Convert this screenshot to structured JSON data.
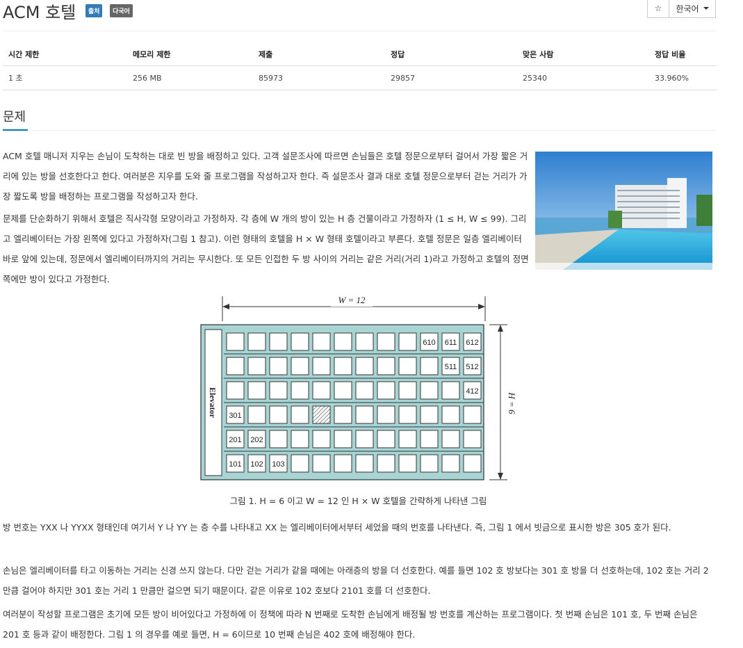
{
  "header": {
    "title": "ACM 호텔",
    "badges": [
      "출처",
      "다국어"
    ],
    "star_glyph": "☆",
    "language": "한국어"
  },
  "stats": {
    "headers": [
      "시간 제한",
      "메모리 제한",
      "제출",
      "정답",
      "맞은 사람",
      "정답 비율"
    ],
    "values": [
      "1 초",
      "256 MB",
      "85973",
      "29857",
      "25340",
      "33.960%"
    ]
  },
  "section_title": "문제",
  "paragraphs": [
    "ACM 호텔 매니저 지우는 손님이 도착하는 대로 빈 방을 배정하고 있다. 고객 설문조사에 따르면 손님들은 호텔 정문으로부터 걸어서 가장 짧은 거리에 있는 방을 선호한다고 한다. 여러분은 지우를 도와 줄 프로그램을 작성하고자 한다. 즉 설문조사 결과 대로 호텔 정문으로부터 걷는 거리가 가장 짧도록 방을 배정하는 프로그램을 작성하고자 한다.",
    "문제를 단순화하기 위해서 호텔은 직사각형 모양이라고 가정하자. 각 층에 W 개의 방이 있는 H 층 건물이라고 가정하자 (1 ≤ H, W ≤ 99). 그리고 엘리베이터는 가장 왼쪽에 있다고 가정하자(그림 1 참고). 이런 형태의 호텔을 H × W 형태 호텔이라고 부른다. 호텔 정문은 일층 엘리베이터 바로 앞에 있는데, 정문에서 엘리베이터까지의 거리는 무시한다. 또 모든 인접한 두 방 사이의 거리는 같은 거리(거리 1)라고 가정하고 호텔의 정면 쪽에만 방이 있다고 가정한다.",
    "방 번호는 YXX 나 YYXX 형태인데 여기서 Y 나 YY 는 층 수를 나타내고 XX 는 엘리베이터에서부터 세었을 때의 번호를 나타낸다. 즉, 그림 1 에서 빗금으로 표시한 방은 305 호가 된다.",
    "손님은 엘리베이터를 타고 이동하는 거리는 신경 쓰지 않는다. 다만 걷는 거리가 같을 때에는 아래층의 방을 더 선호한다. 예를 들면 102 호 방보다는 301 호 방을 더 선호하는데, 102 호는 거리 2 만큼 걸어야 하지만 301 호는 거리 1 만큼만 걸으면 되기 때문이다. 같은 이유로 102 호보다 2101 호를 더 선호한다.",
    "여러분이 작성할 프로그램은 초기에 모든 방이 비어있다고 가정하에 이 정책에 따라 N 번째로 도착한 손님에게 배정될 방 번호를 계산하는 프로그램이다. 첫 번째 손님은 101 호, 두 번째 손님은 201 호 등과 같이 배정한다. 그림 1 의 경우를 예로 들면, H = 6이므로 10 번째 손님은 402 호에 배정해야 한다."
  ],
  "figure": {
    "w_label": "W = 12",
    "h_label": "H = 6",
    "elevator_label": "Elevator",
    "room_labels": [
      {
        "floor": 6,
        "col": 10,
        "text": "610"
      },
      {
        "floor": 6,
        "col": 11,
        "text": "611"
      },
      {
        "floor": 6,
        "col": 12,
        "text": "612"
      },
      {
        "floor": 5,
        "col": 11,
        "text": "511"
      },
      {
        "floor": 5,
        "col": 12,
        "text": "512"
      },
      {
        "floor": 4,
        "col": 12,
        "text": "412"
      },
      {
        "floor": 3,
        "col": 1,
        "text": "301"
      },
      {
        "floor": 2,
        "col": 1,
        "text": "201"
      },
      {
        "floor": 2,
        "col": 2,
        "text": "202"
      },
      {
        "floor": 1,
        "col": 1,
        "text": "101"
      },
      {
        "floor": 1,
        "col": 2,
        "text": "102"
      },
      {
        "floor": 1,
        "col": 3,
        "text": "103"
      }
    ],
    "hatched_room": {
      "floor": 3,
      "col": 5
    },
    "floors": 6,
    "rooms_per_floor": 12,
    "caption": "그림 1. H = 6 이고 W = 12 인 H × W 호텔을 간략하게 나타낸 그림"
  },
  "colors": {
    "accent": "#0076c0",
    "badge_blue": "#337ab7",
    "badge_gray": "#666666",
    "hotel_fill": "#a8d4d4"
  }
}
